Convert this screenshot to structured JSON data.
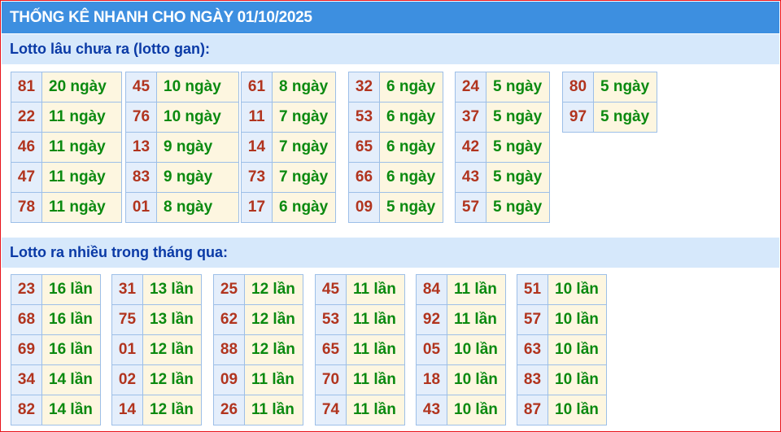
{
  "title": "THỐNG KÊ NHANH CHO NGÀY 01/10/2025",
  "gan": {
    "heading": "Lotto lâu chưa ra (lotto gan):",
    "groups": [
      [
        [
          "81",
          "20 ngày"
        ],
        [
          "22",
          "11 ngày"
        ],
        [
          "46",
          "11 ngày"
        ],
        [
          "47",
          "11 ngày"
        ],
        [
          "78",
          "11 ngày"
        ]
      ],
      [
        [
          "45",
          "10 ngày"
        ],
        [
          "76",
          "10 ngày"
        ],
        [
          "13",
          "9 ngày"
        ],
        [
          "83",
          "9 ngày"
        ],
        [
          "01",
          "8 ngày"
        ]
      ],
      [
        [
          "61",
          "8 ngày"
        ],
        [
          "11",
          "7 ngày"
        ],
        [
          "14",
          "7 ngày"
        ],
        [
          "73",
          "7 ngày"
        ],
        [
          "17",
          "6 ngày"
        ]
      ],
      [
        [
          "32",
          "6 ngày"
        ],
        [
          "53",
          "6 ngày"
        ],
        [
          "65",
          "6 ngày"
        ],
        [
          "66",
          "6 ngày"
        ],
        [
          "09",
          "5 ngày"
        ]
      ],
      [
        [
          "24",
          "5 ngày"
        ],
        [
          "37",
          "5 ngày"
        ],
        [
          "42",
          "5 ngày"
        ],
        [
          "43",
          "5 ngày"
        ],
        [
          "57",
          "5 ngày"
        ]
      ],
      [
        [
          "80",
          "5 ngày"
        ],
        [
          "97",
          "5 ngày"
        ]
      ]
    ]
  },
  "nhieu": {
    "heading": "Lotto ra nhiều trong tháng qua:",
    "groups": [
      [
        [
          "23",
          "16 lần"
        ],
        [
          "68",
          "16 lần"
        ],
        [
          "69",
          "16 lần"
        ],
        [
          "34",
          "14 lần"
        ],
        [
          "82",
          "14 lần"
        ]
      ],
      [
        [
          "31",
          "13 lần"
        ],
        [
          "75",
          "13 lần"
        ],
        [
          "01",
          "12 lần"
        ],
        [
          "02",
          "12 lần"
        ],
        [
          "14",
          "12 lần"
        ]
      ],
      [
        [
          "25",
          "12 lần"
        ],
        [
          "62",
          "12 lần"
        ],
        [
          "88",
          "12 lần"
        ],
        [
          "09",
          "11 lần"
        ],
        [
          "26",
          "11 lần"
        ]
      ],
      [
        [
          "45",
          "11 lần"
        ],
        [
          "53",
          "11 lần"
        ],
        [
          "65",
          "11 lần"
        ],
        [
          "70",
          "11 lần"
        ],
        [
          "74",
          "11 lần"
        ]
      ],
      [
        [
          "84",
          "11 lần"
        ],
        [
          "92",
          "11 lần"
        ],
        [
          "05",
          "10 lần"
        ],
        [
          "18",
          "10 lần"
        ],
        [
          "43",
          "10 lần"
        ]
      ],
      [
        [
          "51",
          "10 lần"
        ],
        [
          "57",
          "10 lần"
        ],
        [
          "63",
          "10 lần"
        ],
        [
          "83",
          "10 lần"
        ],
        [
          "87",
          "10 lần"
        ]
      ]
    ]
  }
}
